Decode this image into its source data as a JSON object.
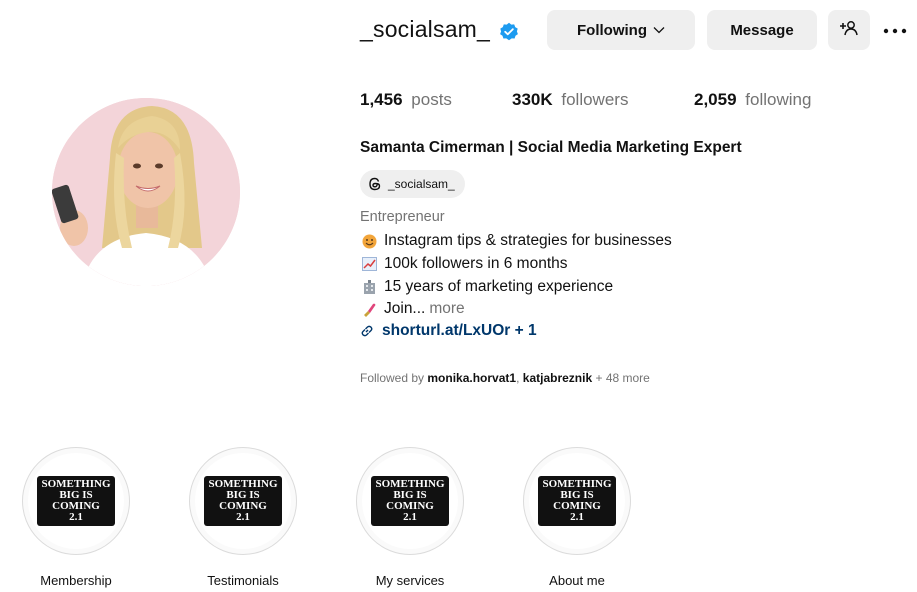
{
  "profile": {
    "username": "_socialsam_",
    "following_button": "Following",
    "message_button": "Message",
    "stats": {
      "posts_count": "1,456",
      "posts_label": "posts",
      "followers_count": "330K",
      "followers_label": "followers",
      "following_count": "2,059",
      "following_label": "following"
    },
    "full_name": "Samanta Cimerman | Social Media Marketing Expert",
    "threads_handle": "_socialsam_",
    "category": "Entrepreneur",
    "bio": [
      {
        "emoji": "smiling-face",
        "text": "Instagram tips & strategies for businesses"
      },
      {
        "emoji": "chart-increasing",
        "text": "100k followers in 6 months"
      },
      {
        "emoji": "office-building",
        "text": "15 years of marketing experience"
      },
      {
        "emoji": "lipstick",
        "text": "Join...",
        "more": "more"
      }
    ],
    "link": "shorturl.at/LxUOr + 1",
    "followed_by": {
      "prefix": "Followed by",
      "user1": "monika.horvat1",
      "separator": ",",
      "user2": "katjabreznik",
      "suffix": "+ 48 more"
    }
  },
  "highlights": [
    {
      "label": "Membership",
      "cover_text": [
        "SOMETHING",
        "BIG IS",
        "COMING",
        "2.1"
      ]
    },
    {
      "label": "Testimonials",
      "cover_text": [
        "SOMETHING",
        "BIG IS",
        "COMING",
        "2.1"
      ]
    },
    {
      "label": "My services",
      "cover_text": [
        "SOMETHING",
        "BIG IS",
        "COMING",
        "2.1"
      ]
    },
    {
      "label": "About me",
      "cover_text": [
        "SOMETHING",
        "BIG IS",
        "COMING",
        "2.1"
      ]
    }
  ],
  "colors": {
    "verified": "#1d9bf0",
    "link": "#00376b",
    "secondary_text": "#737373",
    "button_bg": "#efefef",
    "avatar_bg": "#f3d4d9"
  }
}
